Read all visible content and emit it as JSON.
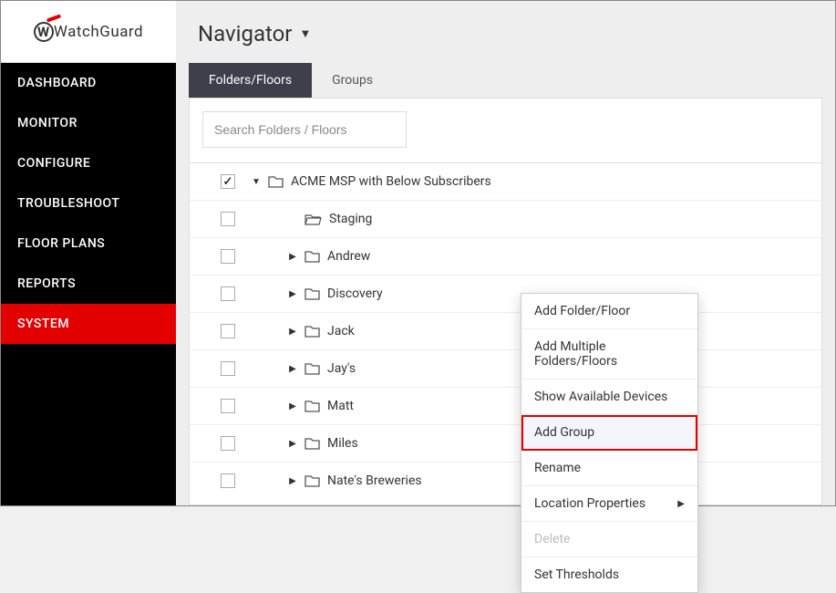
{
  "brand": "WatchGuard",
  "sidebar": {
    "items": [
      {
        "label": "DASHBOARD",
        "active": false
      },
      {
        "label": "MONITOR",
        "active": false
      },
      {
        "label": "CONFIGURE",
        "active": false
      },
      {
        "label": "TROUBLESHOOT",
        "active": false
      },
      {
        "label": "FLOOR PLANS",
        "active": false
      },
      {
        "label": "REPORTS",
        "active": false
      },
      {
        "label": "SYSTEM",
        "active": true
      }
    ]
  },
  "header": {
    "title": "Navigator"
  },
  "tabs": {
    "items": [
      {
        "label": "Folders/Floors",
        "active": true
      },
      {
        "label": "Groups",
        "active": false
      }
    ]
  },
  "search": {
    "placeholder": "Search Folders / Floors"
  },
  "tree": {
    "root": {
      "label": "ACME MSP with Below Subscribers",
      "checked": true,
      "expanded": true,
      "icon": "folder"
    },
    "children": [
      {
        "label": "Staging",
        "icon": "folder-open",
        "expandable": false
      },
      {
        "label": "Andrew",
        "icon": "folder",
        "expandable": true
      },
      {
        "label": "Discovery",
        "icon": "folder",
        "expandable": true
      },
      {
        "label": "Jack",
        "icon": "folder",
        "expandable": true
      },
      {
        "label": "Jay's",
        "icon": "folder",
        "expandable": true
      },
      {
        "label": "Matt",
        "icon": "folder",
        "expandable": true
      },
      {
        "label": "Miles",
        "icon": "folder",
        "expandable": true
      },
      {
        "label": "Nate's Breweries",
        "icon": "folder",
        "expandable": true
      }
    ]
  },
  "context_menu": {
    "items": [
      {
        "label": "Add Folder/Floor"
      },
      {
        "label": "Add Multiple Folders/Floors"
      },
      {
        "label": "Show Available Devices"
      },
      {
        "label": "Add Group",
        "highlight": true
      },
      {
        "label": "Rename"
      },
      {
        "label": "Location Properties",
        "submenu": true
      },
      {
        "label": "Delete",
        "disabled": true
      },
      {
        "label": "Set Thresholds"
      }
    ]
  }
}
